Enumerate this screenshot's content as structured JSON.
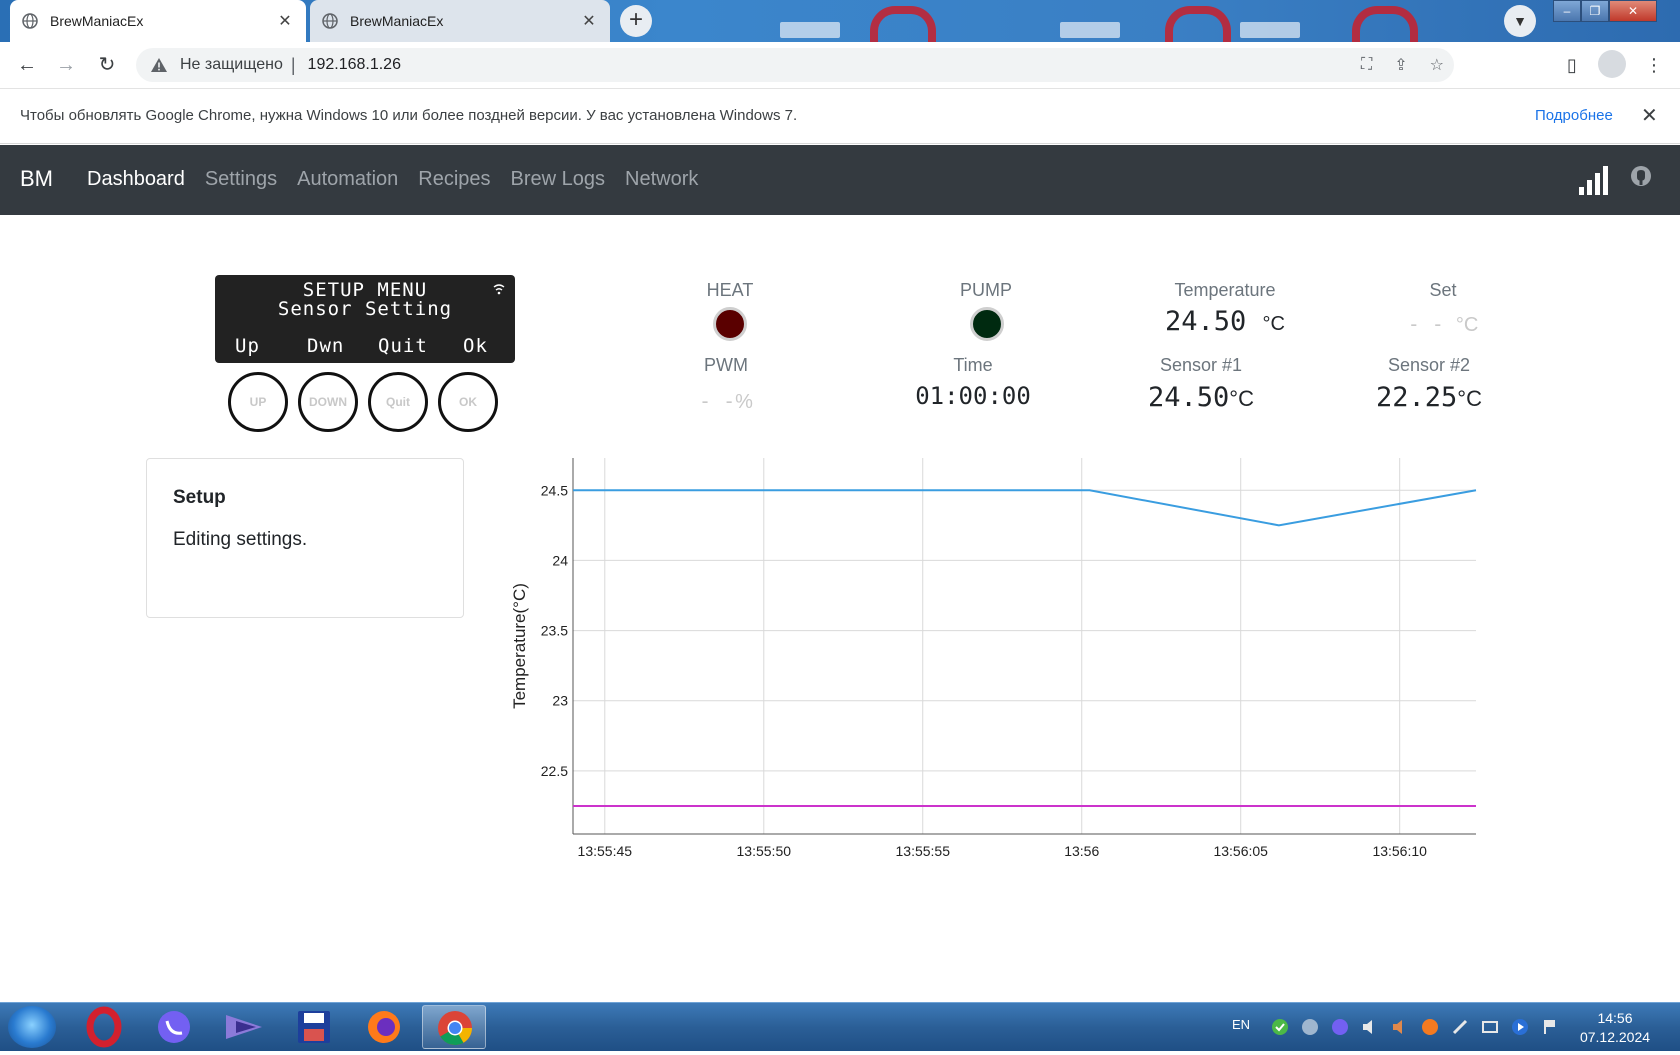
{
  "browser": {
    "tabs": [
      {
        "title": "BrewManiacEx",
        "active": true
      },
      {
        "title": "BrewManiacEx",
        "active": false
      }
    ],
    "new_tab_label": "+",
    "address": {
      "security_label": "Не защищено",
      "separator": "|",
      "url": "192.168.1.26"
    },
    "infobar": {
      "message": "Чтобы обновлять Google Chrome, нужна Windows 10 или более поздней версии. У вас установлена Windows 7.",
      "link": "Подробнее"
    }
  },
  "app": {
    "brand": "BM",
    "nav": [
      {
        "label": "Dashboard",
        "active": true
      },
      {
        "label": "Settings",
        "active": false
      },
      {
        "label": "Automation",
        "active": false
      },
      {
        "label": "Recipes",
        "active": false
      },
      {
        "label": "Brew Logs",
        "active": false
      },
      {
        "label": "Network",
        "active": false
      }
    ]
  },
  "lcd": {
    "line1": "SETUP MENU",
    "line2": "Sensor Setting",
    "buttons": [
      "Up",
      "Dwn",
      "Quit",
      "Ok"
    ]
  },
  "control_buttons": [
    "UP",
    "DOWN",
    "Quit",
    "OK"
  ],
  "status": {
    "heat": {
      "label": "HEAT",
      "color": "#5a0000"
    },
    "pump": {
      "label": "PUMP",
      "color": "#002a10"
    },
    "temperature": {
      "label": "Temperature",
      "value": "24.50",
      "unit": "°C"
    },
    "set": {
      "label": "Set",
      "value": "- -",
      "unit": "°C"
    },
    "pwm": {
      "label": "PWM",
      "value": "- -",
      "unit": "%"
    },
    "time": {
      "label": "Time",
      "value": "01:00:00"
    },
    "sensor1": {
      "label": "Sensor #1",
      "value": "24.50",
      "unit": "°C"
    },
    "sensor2": {
      "label": "Sensor #2",
      "value": "22.25",
      "unit": "°C"
    }
  },
  "setup_card": {
    "title": "Setup",
    "text": "Editing settings."
  },
  "chart_data": {
    "type": "line",
    "ylabel": "Temperature(°C)",
    "xlabel": "",
    "x_ticks": [
      "13:55:45",
      "13:55:50",
      "13:55:55",
      "13:56",
      "13:56:05",
      "13:56:10"
    ],
    "x_tick_seconds": [
      45,
      50,
      55,
      60,
      65,
      70
    ],
    "xlim_seconds": [
      44,
      72.4
    ],
    "y_ticks": [
      22.5,
      23,
      23.5,
      24,
      24.5
    ],
    "ylim": [
      22.05,
      24.73
    ],
    "grid": true,
    "series": [
      {
        "color": "#3a9de0",
        "x_seconds": [
          44,
          60.25,
          66.2,
          72.4
        ],
        "values": [
          24.5,
          24.5,
          24.25,
          24.5
        ]
      },
      {
        "color": "#cc33cc",
        "x_seconds": [
          44,
          72.4
        ],
        "values": [
          22.25,
          22.25
        ]
      }
    ]
  },
  "taskbar": {
    "language": "EN",
    "time": "14:56",
    "date": "07.12.2024"
  }
}
